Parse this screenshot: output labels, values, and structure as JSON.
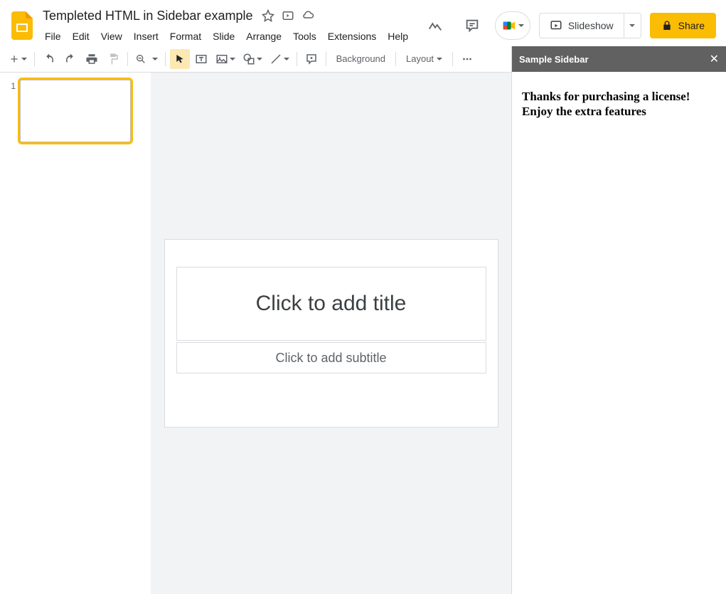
{
  "doc": {
    "title": "Templeted HTML in Sidebar example"
  },
  "menus": {
    "file": "File",
    "edit": "Edit",
    "view": "View",
    "insert": "Insert",
    "format": "Format",
    "slide": "Slide",
    "arrange": "Arrange",
    "tools": "Tools",
    "extensions": "Extensions",
    "help": "Help"
  },
  "header": {
    "slideshow": "Slideshow",
    "share": "Share"
  },
  "toolbar": {
    "background": "Background",
    "layout": "Layout"
  },
  "filmstrip": {
    "slides": [
      {
        "num": "1"
      }
    ]
  },
  "canvas": {
    "title_placeholder": "Click to add title",
    "subtitle_placeholder": "Click to add subtitle"
  },
  "sidebar": {
    "title": "Sample Sidebar",
    "message": "Thanks for purchasing a license! Enjoy the extra features"
  }
}
